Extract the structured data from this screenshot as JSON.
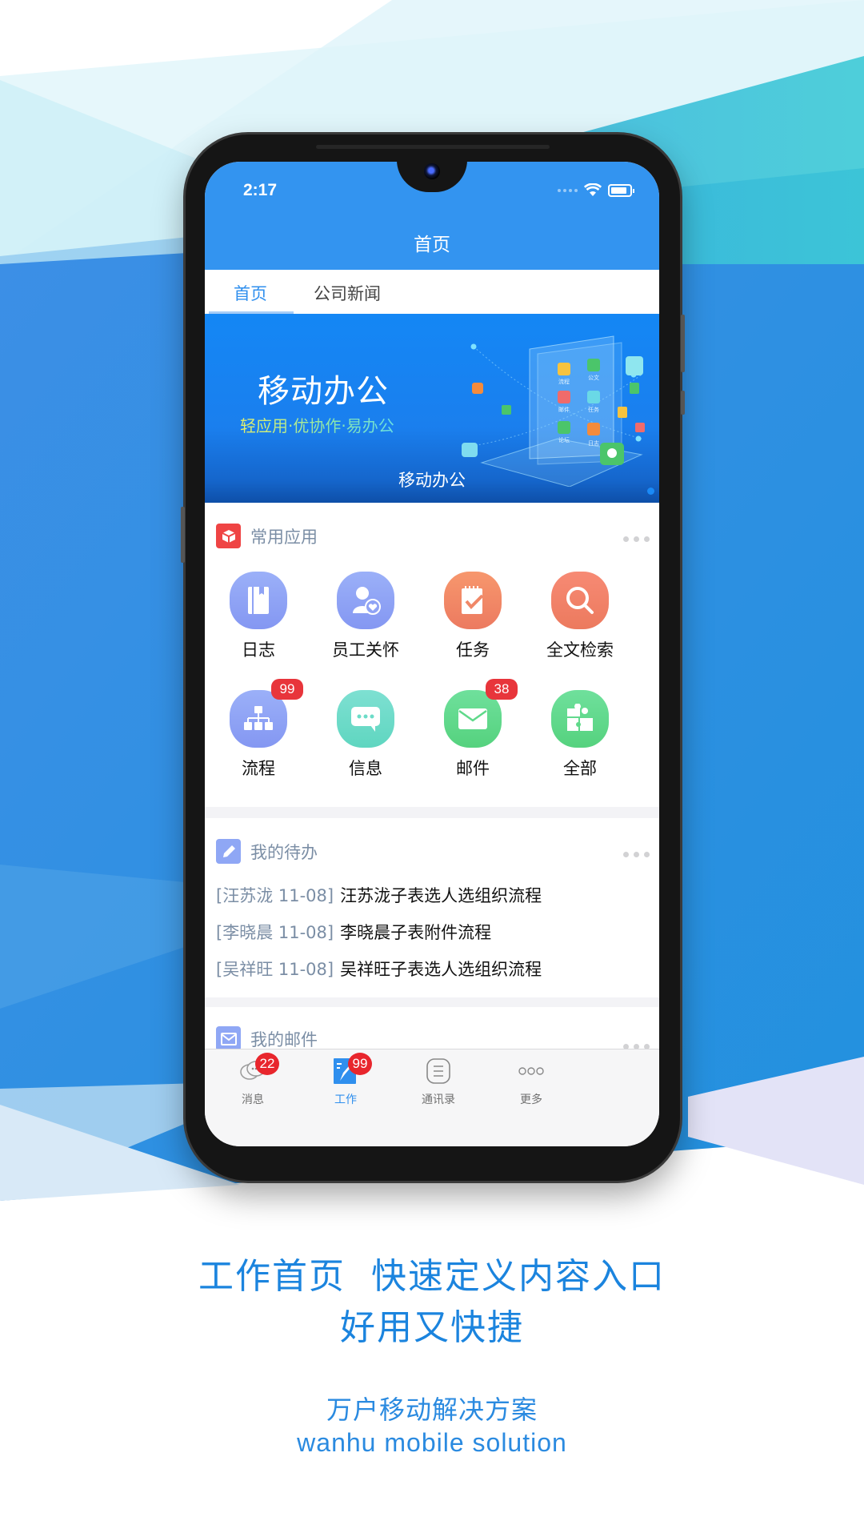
{
  "status_bar": {
    "time": "2:17"
  },
  "header": {
    "title": "首页"
  },
  "tabs": [
    {
      "label": "首页",
      "active": true
    },
    {
      "label": "公司新闻",
      "active": false
    }
  ],
  "banner": {
    "title": "移动办公",
    "subtitle": "轻应用·优协作·易办公",
    "caption": "移动办公",
    "illustration_labels": [
      "流程",
      "公文",
      "邮件",
      "任务",
      "论坛",
      "日志"
    ]
  },
  "common_apps": {
    "title": "常用应用",
    "items": [
      {
        "label": "日志",
        "icon": "notebook-icon",
        "color": "#8fa3f5"
      },
      {
        "label": "员工关怀",
        "icon": "employee-care-icon",
        "color": "#8fa3f5"
      },
      {
        "label": "任务",
        "icon": "task-icon",
        "color": "#f08868"
      },
      {
        "label": "全文检索",
        "icon": "search-icon",
        "color": "#f08868"
      },
      {
        "label": "流程",
        "icon": "flowchart-icon",
        "color": "#8fa3f5",
        "badge": "99"
      },
      {
        "label": "信息",
        "icon": "chat-bubble-icon",
        "color": "#6cdcc8"
      },
      {
        "label": "邮件",
        "icon": "mail-icon",
        "color": "#5fd98a",
        "badge": "38"
      },
      {
        "label": "全部",
        "icon": "puzzle-icon",
        "color": "#5fd98a"
      }
    ]
  },
  "todo": {
    "title": "我的待办",
    "items": [
      {
        "meta": "[汪苏泷 11-08]",
        "text": "汪苏泷子表选人选组织流程"
      },
      {
        "meta": "[李晓晨 11-08]",
        "text": "李晓晨子表附件流程"
      },
      {
        "meta": "[吴祥旺 11-08]",
        "text": "吴祥旺子表选人选组织流程"
      }
    ]
  },
  "mail": {
    "title": "我的邮件"
  },
  "bottom_nav": [
    {
      "label": "消息",
      "badge": "22",
      "active": false
    },
    {
      "label": "工作",
      "badge": "99",
      "active": true
    },
    {
      "label": "通讯录",
      "active": false
    },
    {
      "label": "更多",
      "active": false
    }
  ],
  "promo": {
    "line1": "工作首页  快速定义内容入口",
    "line2": "好用又快捷",
    "line3": "万户移动解决方案",
    "line4": "wanhu mobile solution"
  },
  "colors": {
    "brand_blue": "#3394f0",
    "accent_text": "#1b84de",
    "badge_red": "#e8353b"
  }
}
